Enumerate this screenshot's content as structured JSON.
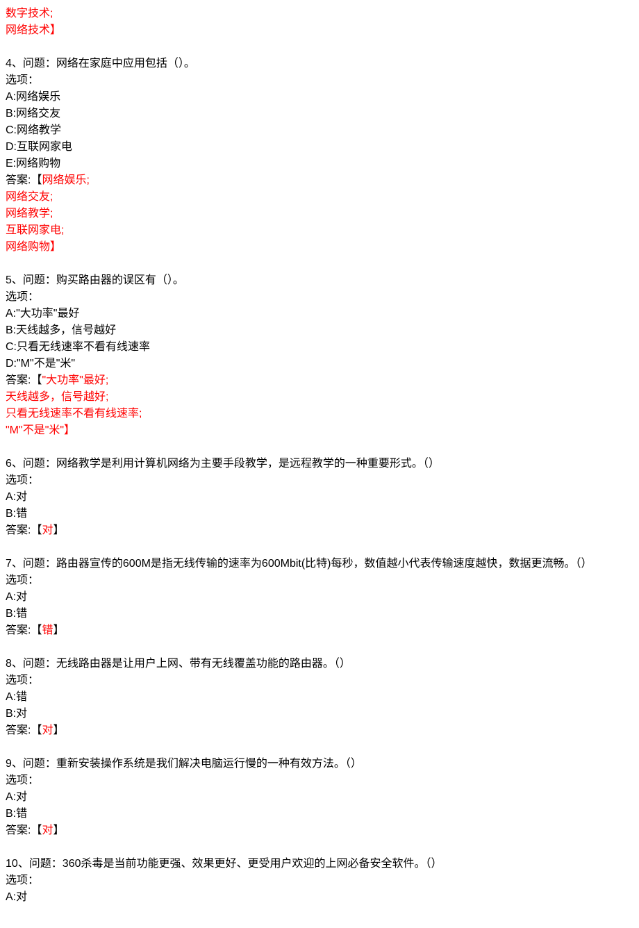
{
  "top_fragment": {
    "line1": "数字技术;",
    "line2": "网络技术】"
  },
  "q4": {
    "question": "4、问题：网络在家庭中应用包括（）。",
    "options_label": "选项：",
    "opt_a": "A:网络娱乐",
    "opt_b": "B:网络交友",
    "opt_c": "C:网络教学",
    "opt_d": "D:互联网家电",
    "opt_e": "E:网络购物",
    "answer_prefix": "答案:【",
    "answer_l1": "网络娱乐;",
    "answer_l2": "网络交友;",
    "answer_l3": "网络教学;",
    "answer_l4": "互联网家电;",
    "answer_l5": "网络购物】"
  },
  "q5": {
    "question": "5、问题：购买路由器的误区有（）。",
    "options_label": "选项：",
    "opt_a": "A:\"大功率\"最好",
    "opt_b": "B:天线越多，信号越好",
    "opt_c": "C:只看无线速率不看有线速率",
    "opt_d": "D:\"M\"不是\"米\"",
    "answer_prefix": "答案:【",
    "answer_l1": "\"大功率\"最好;",
    "answer_l2": "天线越多，信号越好;",
    "answer_l3": "只看无线速率不看有线速率;",
    "answer_l4": "\"M\"不是\"米\"】"
  },
  "q6": {
    "question": "6、问题：网络教学是利用计算机网络为主要手段教学，是远程教学的一种重要形式。（）",
    "options_label": "选项：",
    "opt_a": "A:对",
    "opt_b": "B:错",
    "answer_prefix": "答案:【",
    "answer_text": "对",
    "answer_suffix": "】"
  },
  "q7": {
    "question": "7、问题：路由器宣传的600M是指无线传输的速率为600Mbit(比特)每秒，数值越小代表传输速度越快，数据更流畅。（）",
    "options_label": "选项：",
    "opt_a": "A:对",
    "opt_b": "B:错",
    "answer_prefix": "答案:【",
    "answer_text": "错",
    "answer_suffix": "】"
  },
  "q8": {
    "question": "8、问题：无线路由器是让用户上网、带有无线覆盖功能的路由器。（）",
    "options_label": "选项：",
    "opt_a": "A:错",
    "opt_b": "B:对",
    "answer_prefix": "答案:【",
    "answer_text": "对",
    "answer_suffix": "】"
  },
  "q9": {
    "question": "9、问题：重新安装操作系统是我们解决电脑运行慢的一种有效方法。（）",
    "options_label": "选项：",
    "opt_a": "A:对",
    "opt_b": "B:错",
    "answer_prefix": "答案:【",
    "answer_text": "对",
    "answer_suffix": "】"
  },
  "q10": {
    "question": "10、问题：360杀毒是当前功能更强、效果更好、更受用户欢迎的上网必备安全软件。（）",
    "options_label": "选项：",
    "opt_a": "A:对"
  }
}
